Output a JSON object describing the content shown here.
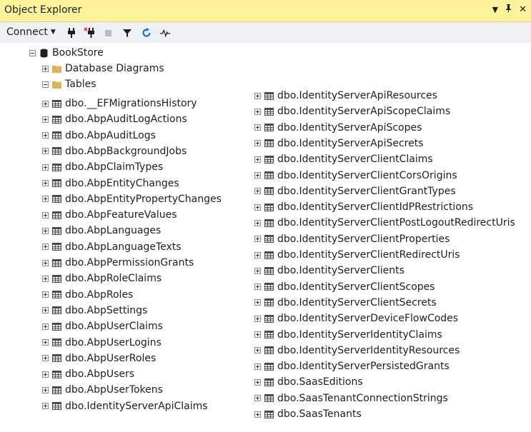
{
  "window": {
    "title": "Object Explorer",
    "controls": {
      "dropdown": "▾",
      "pin": "ꟷ",
      "close": "✕"
    }
  },
  "toolbar": {
    "connect_label": "Connect",
    "icons": [
      "connect-plug-icon",
      "disconnect-plug-icon",
      "stop-icon",
      "filter-icon",
      "refresh-icon",
      "activity-monitor-icon"
    ]
  },
  "tree": {
    "server": "BookStore",
    "folders": [
      {
        "label": "Database Diagrams",
        "expanded": false
      },
      {
        "label": "Tables",
        "expanded": true
      }
    ],
    "tables_col1": [
      "dbo.__EFMigrationsHistory",
      "dbo.AbpAuditLogActions",
      "dbo.AbpAuditLogs",
      "dbo.AbpBackgroundJobs",
      "dbo.AbpClaimTypes",
      "dbo.AbpEntityChanges",
      "dbo.AbpEntityPropertyChanges",
      "dbo.AbpFeatureValues",
      "dbo.AbpLanguages",
      "dbo.AbpLanguageTexts",
      "dbo.AbpPermissionGrants",
      "dbo.AbpRoleClaims",
      "dbo.AbpRoles",
      "dbo.AbpSettings",
      "dbo.AbpUserClaims",
      "dbo.AbpUserLogins",
      "dbo.AbpUserRoles",
      "dbo.AbpUsers",
      "dbo.AbpUserTokens",
      "dbo.IdentityServerApiClaims"
    ],
    "tables_col2": [
      "dbo.IdentityServerApiResources",
      "dbo.IdentityServerApiScopeClaims",
      "dbo.IdentityServerApiScopes",
      "dbo.IdentityServerApiSecrets",
      "dbo.IdentityServerClientClaims",
      "dbo.IdentityServerClientCorsOrigins",
      "dbo.IdentityServerClientGrantTypes",
      "dbo.IdentityServerClientIdPRestrictions",
      "dbo.IdentityServerClientPostLogoutRedirectUris",
      "dbo.IdentityServerClientProperties",
      "dbo.IdentityServerClientRedirectUris",
      "dbo.IdentityServerClients",
      "dbo.IdentityServerClientScopes",
      "dbo.IdentityServerClientSecrets",
      "dbo.IdentityServerDeviceFlowCodes",
      "dbo.IdentityServerIdentityClaims",
      "dbo.IdentityServerIdentityResources",
      "dbo.IdentityServerPersistedGrants",
      "dbo.SaasEditions",
      "dbo.SaasTenantConnectionStrings",
      "dbo.SaasTenants"
    ]
  },
  "colors": {
    "title_bar": "#fff29d",
    "toolbar": "#eef0f5",
    "folder": "#dcb35c",
    "refresh": "#1e73be"
  }
}
